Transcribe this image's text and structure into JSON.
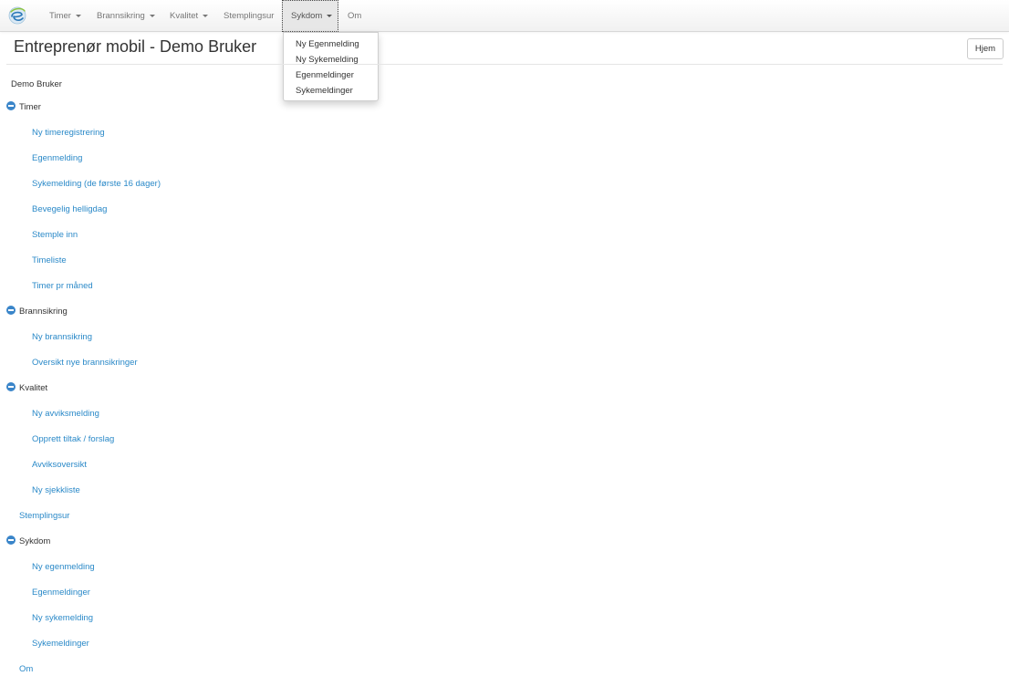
{
  "nav": {
    "items": [
      {
        "label": "Timer",
        "dropdown": true
      },
      {
        "label": "Brannsikring",
        "dropdown": true
      },
      {
        "label": "Kvalitet",
        "dropdown": true
      },
      {
        "label": "Stemplingsur",
        "dropdown": false
      },
      {
        "label": "Sykdom",
        "dropdown": true,
        "open": true
      },
      {
        "label": "Om",
        "dropdown": false
      }
    ],
    "open_menu": {
      "items": [
        "Ny Egenmelding",
        "Ny Sykemelding",
        "Egenmeldinger",
        "Sykemeldinger"
      ]
    }
  },
  "header": {
    "title": "Entreprenør mobil - Demo Bruker",
    "home_button": "Hjem"
  },
  "tree": {
    "root": "Demo Bruker",
    "groups": [
      {
        "label": "Timer",
        "children": [
          "Ny timeregistrering",
          "Egenmelding",
          "Sykemelding (de første 16 dager)",
          "Bevegelig helligdag",
          "Stemple inn",
          "Timeliste",
          "Timer pr måned"
        ]
      },
      {
        "label": "Brannsikring",
        "children": [
          "Ny brannsikring",
          "Oversikt nye brannsikringer"
        ]
      },
      {
        "label": "Kvalitet",
        "children": [
          "Ny avviksmelding",
          "Opprett tiltak / forslag",
          "Avviksoversikt",
          "Ny sjekkliste"
        ]
      }
    ],
    "stemplingsur": "Stemplingsur",
    "sykdom": {
      "label": "Sykdom",
      "children": [
        "Ny egenmelding",
        "Egenmeldinger",
        "Ny sykemelding",
        "Sykemeldinger"
      ]
    },
    "om": "Om"
  },
  "colors": {
    "link": "#2a89c8",
    "toggle_icon": "#3a85c9",
    "navbar_text": "#777777"
  }
}
